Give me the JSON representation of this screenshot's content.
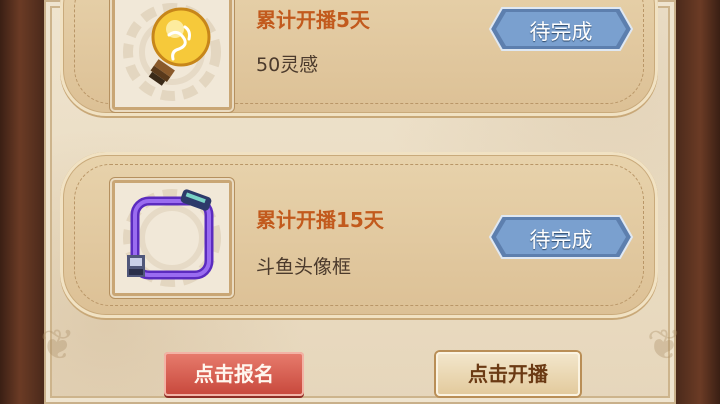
{
  "tasks": [
    {
      "title": "累计开播5天",
      "reward": "50灵感",
      "reward_icon": "lightbulb-icon",
      "status": "待完成"
    },
    {
      "title": "累计开播15天",
      "reward": "斗鱼头像框",
      "reward_icon": "avatar-frame-icon",
      "status": "待完成"
    }
  ],
  "actions": {
    "register_label": "点击报名",
    "broadcast_label": "点击开播"
  },
  "colors": {
    "title": "#c25a1d",
    "status_button": "#6f97c6",
    "register_button": "#d2564a",
    "broadcast_button": "#ead6ad"
  }
}
